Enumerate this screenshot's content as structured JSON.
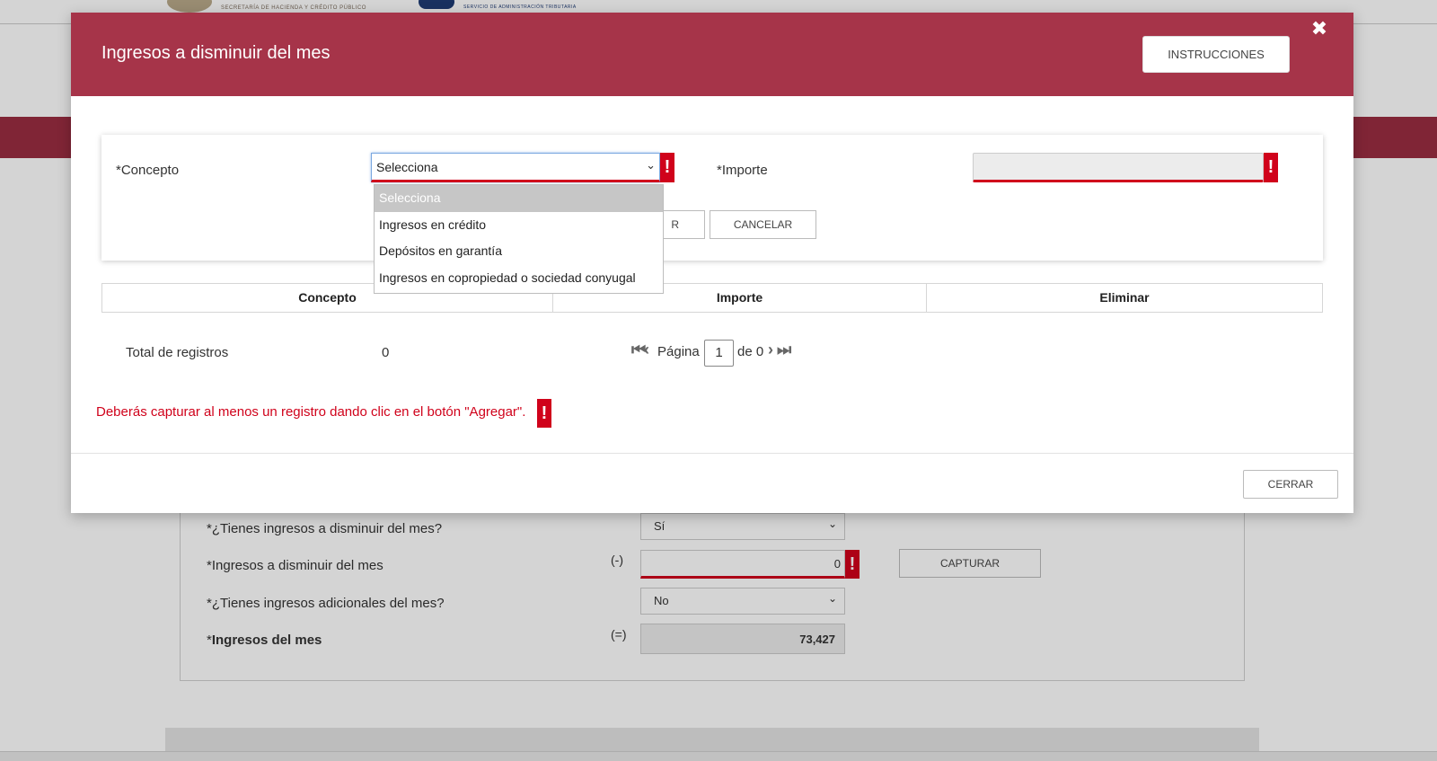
{
  "background": {
    "logos": {
      "left_text": "SECRETARÍA DE HACIENDA Y CRÉDITO PÚBLICO",
      "right_text": "SERVICIO DE ADMINISTRACIÓN TRIBUTARIA"
    },
    "rows": {
      "tienes_disminuir_label": "*¿Tienes ingresos a disminuir del mes?",
      "tienes_disminuir_value": "Sí",
      "ingresos_disminuir_label": "*Ingresos a disminuir del mes",
      "ingresos_disminuir_sign": "(-)",
      "ingresos_disminuir_value": "0",
      "capturar_label": "CAPTURAR",
      "tienes_adicionales_label": "*¿Tienes ingresos adicionales del mes?",
      "tienes_adicionales_value": "No",
      "ingresos_mes_label": "Ingresos del mes",
      "ingresos_mes_prefix": "*",
      "ingresos_mes_sign": "(=)",
      "ingresos_mes_value": "73,427"
    }
  },
  "modal": {
    "title": "Ingresos a disminuir del mes",
    "instrucciones_label": "INSTRUCCIONES",
    "close_glyph": "✖",
    "form": {
      "concepto_label": "*Concepto",
      "concepto_selected": "Selecciona",
      "importe_label": "*Importe",
      "importe_value": "",
      "agregar_partial_label": "R",
      "cancelar_label": "CANCELAR",
      "error_glyph": "!"
    },
    "dropdown": {
      "options": [
        "Selecciona",
        "Ingresos en crédito",
        "Depósitos en garantía",
        "Ingresos en copropiedad o sociedad conyugal"
      ]
    },
    "table": {
      "headers": [
        "Concepto",
        "Importe",
        "Eliminar"
      ]
    },
    "summary": {
      "total_label": "Total de registros",
      "total_value": "0"
    },
    "pagination": {
      "page_label": "Página",
      "current_page": "1",
      "of_label": "de 0"
    },
    "error_message": "Deberás capturar al menos un registro dando clic en el botón \"Agregar\".",
    "cerrar_label": "CERRAR"
  },
  "colors": {
    "header_red": "#a63449",
    "error_red": "#d0021b",
    "bg_redbar": "#9b2d42"
  }
}
